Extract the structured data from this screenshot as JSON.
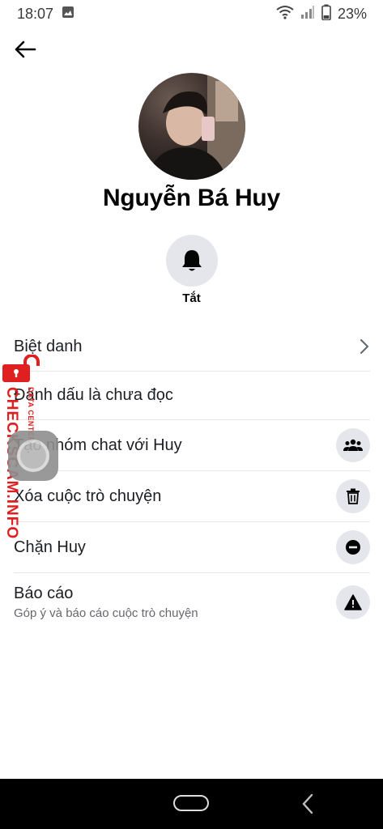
{
  "status_bar": {
    "time": "18:07",
    "battery": "23%",
    "icons": [
      "image-icon",
      "wifi-icon",
      "signal-icon",
      "battery-icon"
    ]
  },
  "header": {
    "back_icon": "arrow-left-icon"
  },
  "profile": {
    "name": "Nguyễn Bá Huy",
    "mute_label": "Tắt",
    "mute_icon": "bell-icon"
  },
  "menu": {
    "items": [
      {
        "label": "Biệt danh",
        "icon": "chevron-right-icon"
      },
      {
        "label": "Đánh dấu là chưa đọc"
      },
      {
        "label": "Tạo nhóm chat với Huy",
        "icon": "group-icon"
      },
      {
        "label": "Xóa cuộc trò chuyện",
        "icon": "trash-icon"
      },
      {
        "label": "Chặn Huy",
        "icon": "block-icon"
      },
      {
        "label": "Báo cáo",
        "sub": "Góp ý và báo cáo cuộc trò chuyện",
        "icon": "warning-icon"
      }
    ]
  },
  "watermark": {
    "brand": "CHECKSCAM.INFO",
    "tagline": "DATA CENTER"
  },
  "colors": {
    "icon_bg": "#e4e6eb",
    "text": "#050505",
    "secondary": "#65676b",
    "watermark_red": "#e02020"
  }
}
